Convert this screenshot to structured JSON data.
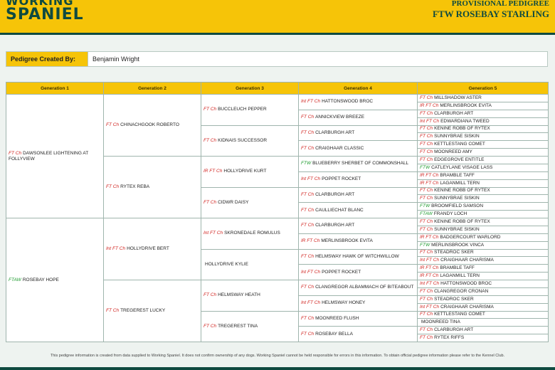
{
  "header": {
    "logo_line1": "WORKING",
    "logo_line2": "SPANIEL",
    "title1": "PROVISIONAL PEDIGREE",
    "title2": "FTW ROSEBAY STARLING"
  },
  "creator": {
    "label": "Pedigree Created By:",
    "value": "Benjamin Wright"
  },
  "columns": [
    "Generation 1",
    "Generation 2",
    "Generation 3",
    "Generation 4",
    "Generation 5"
  ],
  "gen1": [
    {
      "title": "FT Ch",
      "name": "DAWSONLEE LIGHTENING AT FOLLYVIEW"
    },
    {
      "title": "FTAW",
      "name": "ROSEBAY HOPE"
    }
  ],
  "gen2": [
    {
      "title": "FT Ch",
      "name": "CHINACHGOOK ROBERTO"
    },
    {
      "title": "FT Ch",
      "name": "RYTEX REBA"
    },
    {
      "title": "Int FT Ch",
      "name": "HOLLYDRIVE BERT"
    },
    {
      "title": "FT Ch",
      "name": "TREGEREST LUCKY"
    }
  ],
  "gen3": [
    {
      "title": "FT Ch",
      "name": "BUCCLEUCH PEPPER"
    },
    {
      "title": "FT Ch",
      "name": "KIDNAIS SUCCESSOR"
    },
    {
      "title": "IR FT Ch",
      "name": "HOLLYDRIVE KURT"
    },
    {
      "title": "FT Ch",
      "name": "CIDWR DAISY"
    },
    {
      "title": "Int FT Ch",
      "name": "SKRONEDALE ROMULUS"
    },
    {
      "title": "",
      "name": "HOLLYDRIVE KYLIE"
    },
    {
      "title": "FT Ch",
      "name": "HELMSWAY HEATH"
    },
    {
      "title": "FT Ch",
      "name": "TREGEREST TINA"
    }
  ],
  "gen4": [
    {
      "title": "Int FT Ch",
      "name": "HATTONSWOOD BROC"
    },
    {
      "title": "FT Ch",
      "name": "ANNICKVIEW BREEZE"
    },
    {
      "title": "FT Ch",
      "name": "CLARBURGH ART"
    },
    {
      "title": "FT Ch",
      "name": "CRAIGHAAR CLASSIC"
    },
    {
      "title": "FTW",
      "name": "BLUEBERRY SHERBET OF COMMONSHALL"
    },
    {
      "title": "Int FT Ch",
      "name": "POPPET ROCKET"
    },
    {
      "title": "FT Ch",
      "name": "CLARBURGH ART"
    },
    {
      "title": "FT Ch",
      "name": "CAULLIECHAT BLANC"
    },
    {
      "title": "FT Ch",
      "name": "CLARBURGH ART"
    },
    {
      "title": "IR FT Ch",
      "name": "MERLINSBROOK EVITA"
    },
    {
      "title": "FT Ch",
      "name": "HELMSWAY HAWK OF WITCHWILLOW"
    },
    {
      "title": "Int FT Ch",
      "name": "POPPET ROCKET"
    },
    {
      "title": "FT Ch",
      "name": "CLANGREGOR ALBAMMACH OF BITEABOUT"
    },
    {
      "title": "Int FT Ch",
      "name": "HELMSWAY HONEY"
    },
    {
      "title": "FT Ch",
      "name": "MOONREED FLUSH"
    },
    {
      "title": "FT Ch",
      "name": "ROSEBAY BELLA"
    }
  ],
  "gen5": [
    {
      "title": "FT Ch",
      "name": "MILLSHADOW ASTER"
    },
    {
      "title": "IR FT Ch",
      "name": "MERLINSBROOK EVITA"
    },
    {
      "title": "FT Ch",
      "name": "CLARBURGH ART"
    },
    {
      "title": "Int FT Ch",
      "name": "EDWARDIANA TWEED"
    },
    {
      "title": "FT Ch",
      "name": "KENINE ROBB OF RYTEX"
    },
    {
      "title": "FT Ch",
      "name": "SUNNYBRAE SISKIN"
    },
    {
      "title": "FT Ch",
      "name": "KETTLESTANG COMET"
    },
    {
      "title": "FT Ch",
      "name": "MOONREED AMY"
    },
    {
      "title": "FT Ch",
      "name": "EDGEGROVE ENTITLE"
    },
    {
      "title": "FTW",
      "name": "CATLEYLANE VISAGE LASS"
    },
    {
      "title": "IR FT Ch",
      "name": "BRAMBLE TAFF"
    },
    {
      "title": "IR FT Ch",
      "name": "LAGANMILL TERN"
    },
    {
      "title": "FT Ch",
      "name": "KENINE ROBB OF RYTEX"
    },
    {
      "title": "FT Ch",
      "name": "SUNNYBRAE SISKIN"
    },
    {
      "title": "FTW",
      "name": "BROOMFIELD SAMSON"
    },
    {
      "title": "FTAW",
      "name": "FRANDY LOCH"
    },
    {
      "title": "FT Ch",
      "name": "KENINE ROBB OF RYTEX"
    },
    {
      "title": "FT Ch",
      "name": "SUNNYBRAE SISKIN"
    },
    {
      "title": "IR FT Ch",
      "name": "BADGERCOURT WARLORD"
    },
    {
      "title": "FTW",
      "name": "MERLINSBROOK VINCA"
    },
    {
      "title": "FT Ch",
      "name": "STEADROC SKER"
    },
    {
      "title": "Int FT Ch",
      "name": "CRAIGHAAR CHARISMA"
    },
    {
      "title": "IR FT Ch",
      "name": "BRAMBLE TAFF"
    },
    {
      "title": "IR FT Ch",
      "name": "LAGANMILL TERN"
    },
    {
      "title": "Int FT Ch",
      "name": "HATTONSWOOD BROC"
    },
    {
      "title": "FT Ch",
      "name": "CLANGREGOR CRONAN"
    },
    {
      "title": "FT Ch",
      "name": "STEADROC SKER"
    },
    {
      "title": "Int FT Ch",
      "name": "CRAIGHAAR CHARISMA"
    },
    {
      "title": "FT Ch",
      "name": "KETTLESTANG COMET"
    },
    {
      "title": "",
      "name": "MOONREED TINA"
    },
    {
      "title": "FT Ch",
      "name": "CLARBURGH ART"
    },
    {
      "title": "FT Ch",
      "name": "RYTEX RIFFS"
    }
  ],
  "footer": "This pedigree information is created from data supplied to Working Spaniel. It does not confirm ownership of any dogs. Working Spaniel cannot be held responsible for errors in this information. To obtain official pedigree information please refer to the Kennel Club.",
  "colors": {
    "accent": "#f6c408",
    "brand": "#0f4a40",
    "title_red": "#d0221e",
    "title_green": "#1b9a2c"
  }
}
